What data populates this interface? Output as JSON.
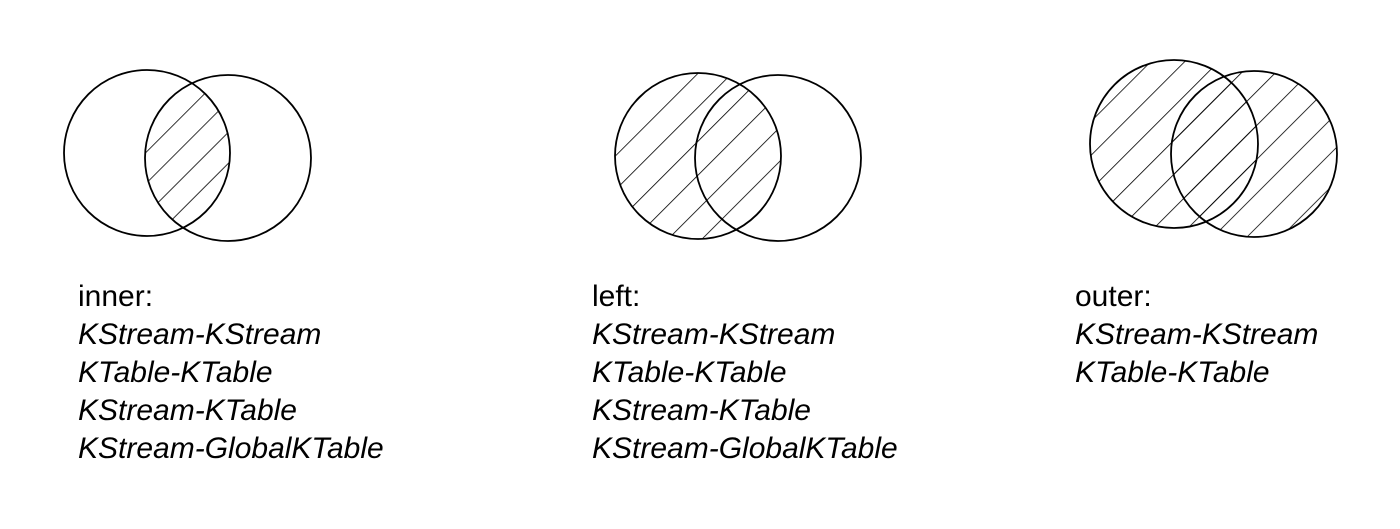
{
  "joins": [
    {
      "type_label": "inner:",
      "combinations": [
        "KStream-KStream",
        "KTable-KTable",
        "KStream-KTable",
        "KStream-GlobalKTable"
      ],
      "shaded_region": "intersection"
    },
    {
      "type_label": "left:",
      "combinations": [
        "KStream-KStream",
        "KTable-KTable",
        "KStream-KTable",
        "KStream-GlobalKTable"
      ],
      "shaded_region": "left-circle"
    },
    {
      "type_label": "outer:",
      "combinations": [
        "KStream-KStream",
        "KTable-KTable"
      ],
      "shaded_region": "union"
    }
  ],
  "colors": {
    "stroke": "#000000",
    "background": "#ffffff"
  }
}
